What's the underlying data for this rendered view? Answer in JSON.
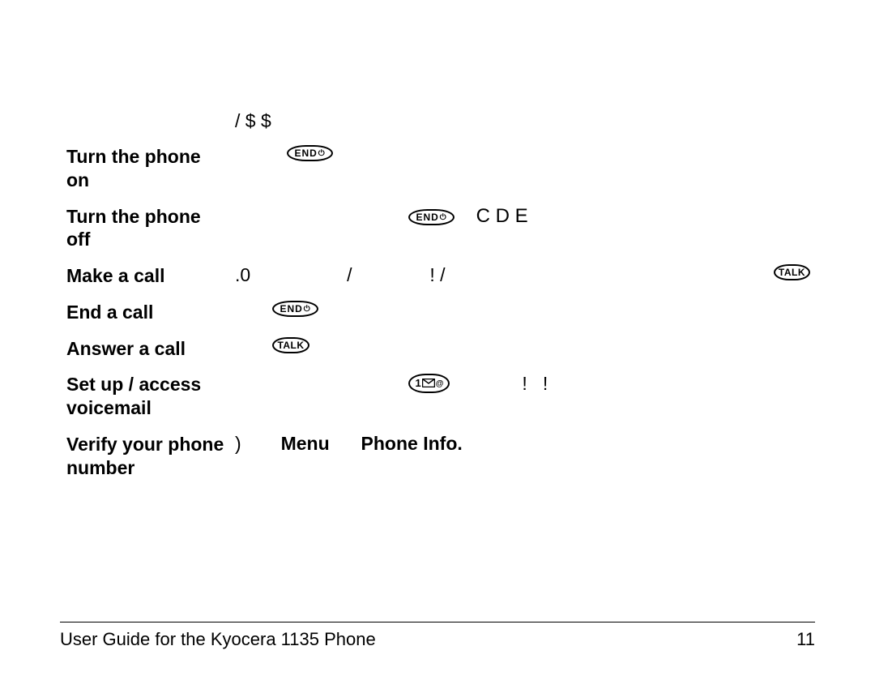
{
  "header": {
    "text": "/    $ $"
  },
  "rows": [
    {
      "label": "Turn the phone on"
    },
    {
      "label": "Turn the phone off",
      "extra": "C     D E"
    },
    {
      "label": "Make a call",
      "left_text": ".0",
      "mid_text": "/               ! /"
    },
    {
      "label": "End a call"
    },
    {
      "label": "Answer a call"
    },
    {
      "label": "Set up / access voicemail",
      "mid_text": "!   !"
    },
    {
      "label": "Verify your phone number",
      "paren": ")",
      "menu": "Menu",
      "phoneinfo": "Phone Info."
    }
  ],
  "keys": {
    "end": "END",
    "talk": "TALK",
    "one": "1",
    "at": "@",
    "power": "⏻"
  },
  "footer": {
    "left": "User Guide for the Kyocera 1135 Phone",
    "right": "11"
  }
}
